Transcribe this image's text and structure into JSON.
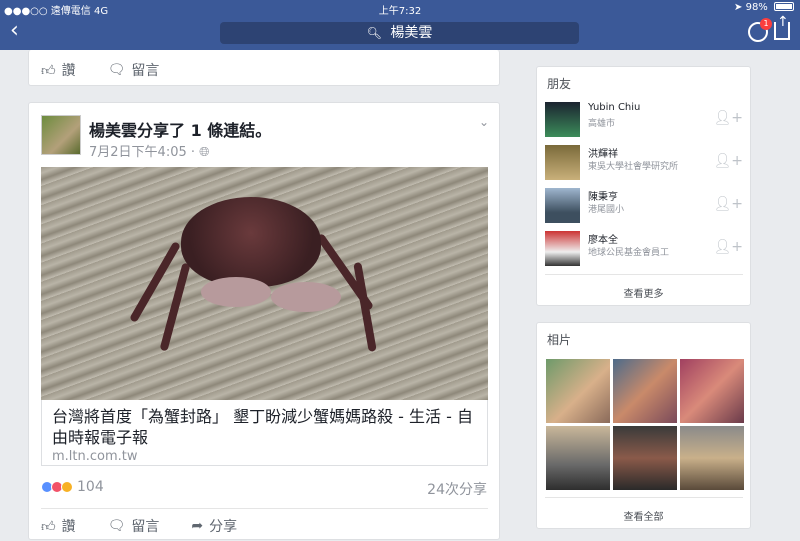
{
  "status": {
    "carrier": "●●●○○ 遠傳電信  4G",
    "time": "上午7:32",
    "battery": "98%"
  },
  "nav": {
    "search_text": "楊美雲",
    "messenger_badge": "1"
  },
  "prev_post": {
    "like_label": "讚",
    "comment_label": "留言"
  },
  "post": {
    "author_line": "楊美雲分享了 1 條連結。",
    "timestamp": "7月2日下午4:05 · ",
    "link_title": "台灣將首度「為蟹封路」 墾丁盼減少蟹媽媽路殺 - 生活 - 自由時報電子報",
    "link_domain": "m.ltn.com.tw",
    "reaction_count": "104",
    "share_count": "24次分享",
    "actions": {
      "like": "讚",
      "comment": "留言",
      "share": "分享"
    }
  },
  "friends": {
    "title": "朋友",
    "items": [
      {
        "name": "Yubin Chiu",
        "sub": "高雄市"
      },
      {
        "name": "洪輝祥",
        "sub": "東吳大學社會學研究所"
      },
      {
        "name": "陳秉亨",
        "sub": "港尾國小"
      },
      {
        "name": "廖本全",
        "sub": "地球公民基金會員工"
      }
    ],
    "see_more": "查看更多"
  },
  "photos": {
    "title": "相片",
    "see_all": "查看全部"
  },
  "colors": {
    "brand": "#3b5998",
    "like_blue": "#5890ff",
    "love_red": "#f25268",
    "haha_yellow": "#f7b125"
  }
}
